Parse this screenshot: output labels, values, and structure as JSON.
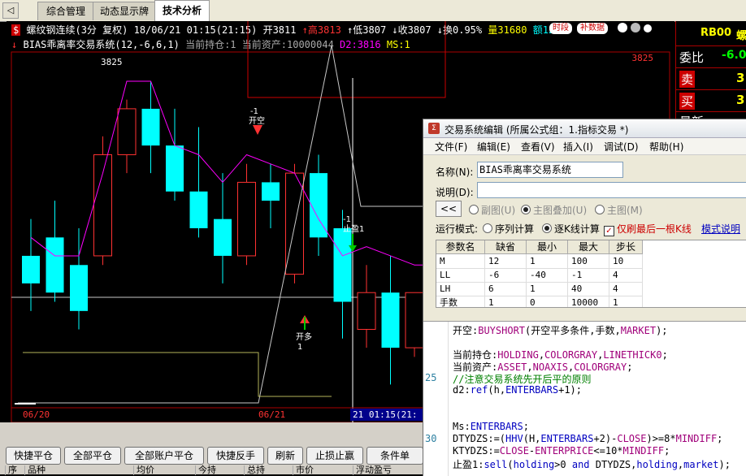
{
  "tabs": {
    "arrow": "◁",
    "items": [
      {
        "label": "综合管理"
      },
      {
        "label": "动态显示牌"
      },
      {
        "label": "技术分析"
      }
    ]
  },
  "chart": {
    "symbol": "螺纹钢连续(3分 复权)",
    "datetime": "18/06/21 01:15(21:15)",
    "open_label": "开3811",
    "high_label": "↑高3813",
    "low_label": "↑低3807",
    "close_label": "↓收3807",
    "change_label": "↓换0.95%",
    "volume_label": "量31680",
    "amount_label": "额12",
    "btn_period": "时段",
    "btn_supplement": "补数据",
    "indicator_line": "BIAS乖离率交易系统(12,-6,6,1)",
    "holding_label": "当前持仓:1",
    "asset_label": "当前资产:10000044",
    "d2_label": "D2:3816",
    "ms_label": "MS:1",
    "price_max_label": "3825",
    "price_right_label": "3825",
    "signal_open_short": "-1\n开空",
    "signal_open_short_line1": "-1",
    "signal_open_short_line2": "开空",
    "signal_stop_line1": "-1",
    "signal_stop_line2": "止盈1",
    "signal_open_long_line1": "开多",
    "signal_open_long_line2": "1",
    "date_labels": [
      "06/20",
      "06/21",
      "21 01:15(21:"
    ],
    "colors": {
      "up": "#ff3232",
      "down": "#00ffff",
      "bias": "#ff00ff",
      "white_line": "#c8c8c8",
      "yellow_line": "#b4b45a"
    }
  },
  "chart_data": {
    "type": "candlestick",
    "categories": [
      1,
      2,
      3,
      4,
      5,
      6,
      7,
      8,
      9,
      10,
      11,
      12,
      13,
      14,
      15,
      16,
      17,
      18
    ],
    "series": [
      {
        "name": "K",
        "values": [
          {
            "o": 3806,
            "h": 3810,
            "l": 3800,
            "c": 3803
          },
          {
            "o": 3808,
            "h": 3812,
            "l": 3801,
            "c": 3802
          },
          {
            "o": 3805,
            "h": 3809,
            "l": 3798,
            "c": 3800
          },
          {
            "o": 3806,
            "h": 3819,
            "l": 3805,
            "c": 3817
          },
          {
            "o": 3817,
            "h": 3823,
            "l": 3815,
            "c": 3822
          },
          {
            "o": 3822,
            "h": 3825,
            "l": 3815,
            "c": 3818
          },
          {
            "o": 3818,
            "h": 3822,
            "l": 3812,
            "c": 3813
          },
          {
            "o": 3813,
            "h": 3820,
            "l": 3808,
            "c": 3809
          },
          {
            "o": 3810,
            "h": 3815,
            "l": 3803,
            "c": 3806
          },
          {
            "o": 3806,
            "h": 3816,
            "l": 3805,
            "c": 3814
          },
          {
            "o": 3814,
            "h": 3816,
            "l": 3809,
            "c": 3812
          },
          {
            "o": 3804,
            "h": 3816,
            "l": 3803,
            "c": 3815
          },
          {
            "o": 3815,
            "h": 3817,
            "l": 3806,
            "c": 3808
          },
          {
            "o": 3809,
            "h": 3811,
            "l": 3797,
            "c": 3801
          },
          {
            "o": 3798,
            "h": 3805,
            "l": 3796,
            "c": 3802
          },
          {
            "o": 3802,
            "h": 3806,
            "l": 3792,
            "c": 3796
          },
          {
            "o": 3796,
            "h": 3802,
            "l": 3795,
            "c": 3802
          },
          {
            "o": 3801,
            "h": 3802,
            "l": 3800,
            "c": 3800
          }
        ]
      },
      {
        "name": "BIAS",
        "values": [
          3808,
          3806,
          3806,
          3815,
          3825,
          3825,
          3818,
          3817,
          3814,
          3817,
          3816,
          3815,
          3810,
          3806,
          3807,
          3806,
          3805,
          3805
        ]
      }
    ],
    "ylim": [
      3790,
      3828
    ]
  },
  "right_panel": {
    "code": "RB00",
    "code_suffix": "螺",
    "rows": [
      {
        "label": "委比",
        "value": "-6.0"
      },
      {
        "label": "卖",
        "value": "3"
      },
      {
        "label": "买",
        "value": "3"
      },
      {
        "label": "最新",
        "value": ""
      }
    ]
  },
  "dialog": {
    "title": "交易系统编辑 (所属公式组：1.指标交易 *)",
    "menu": [
      "文件(F)",
      "编辑(E)",
      "查看(V)",
      "插入(I)",
      "调试(D)",
      "帮助(H)"
    ],
    "name_label": "名称(N):",
    "name_value": "BIAS乖离率交易系统",
    "desc_label": "说明(D):",
    "desc_value": "",
    "back_btn": "<<",
    "chart_mode": {
      "sub": "副图(U)",
      "overlay": "主图叠加(U)",
      "main": "主图(M)"
    },
    "run_mode_label": "运行模式:",
    "run_seq": "序列计算",
    "run_bar": "逐K线计算",
    "refresh_last": "仅刷最后一根K线",
    "mode_help": "模式说明",
    "param_headers": [
      "参数名",
      "缺省",
      "最小",
      "最大",
      "步长"
    ],
    "params": [
      [
        "M",
        "12",
        "1",
        "100",
        "10"
      ],
      [
        "LL",
        "-6",
        "-40",
        "-1",
        "4"
      ],
      [
        "LH",
        "6",
        "1",
        "40",
        "4"
      ],
      [
        "手数",
        "1",
        "0",
        "10000",
        "1"
      ]
    ],
    "code_lines": [
      {
        "n": "",
        "text": "开空:BUYSHORT(开空平多条件,手数,MARKET);"
      },
      {
        "n": "",
        "text": ""
      },
      {
        "n": "",
        "text": "当前持仓:HOLDING,COLORGRAY,LINETHICK0;"
      },
      {
        "n": "",
        "text": "当前资产:ASSET,NOAXIS,COLORGRAY;"
      },
      {
        "n": "25",
        "text": "//注意交易系统先开后平的原则"
      },
      {
        "n": "",
        "text": "d2:ref(h,ENTERBARS+1);"
      },
      {
        "n": "",
        "text": ""
      },
      {
        "n": "",
        "text": ""
      },
      {
        "n": "",
        "text": "Ms:ENTERBARS;"
      },
      {
        "n": "30",
        "text": "DTYDZS:=(HHV(H,ENTERBARS+2)-CLOSE)>=8*MINDIFF;"
      },
      {
        "n": "",
        "text": "KTYDZS:=CLOSE-ENTERPRICE<=10*MINDIFF;"
      },
      {
        "n": "",
        "text": "止盈1:sell(holding>0 and DTYDZS,holding,market);"
      }
    ]
  },
  "quick_buttons": [
    "快捷平仓",
    "全部平仓",
    "全部账户平仓",
    "快捷反手",
    "刷新",
    "止损止赢",
    "条件单"
  ],
  "table_headers": [
    "序",
    "品种",
    "均价",
    "今持",
    "总持",
    "市价",
    "浮动盈亏"
  ]
}
